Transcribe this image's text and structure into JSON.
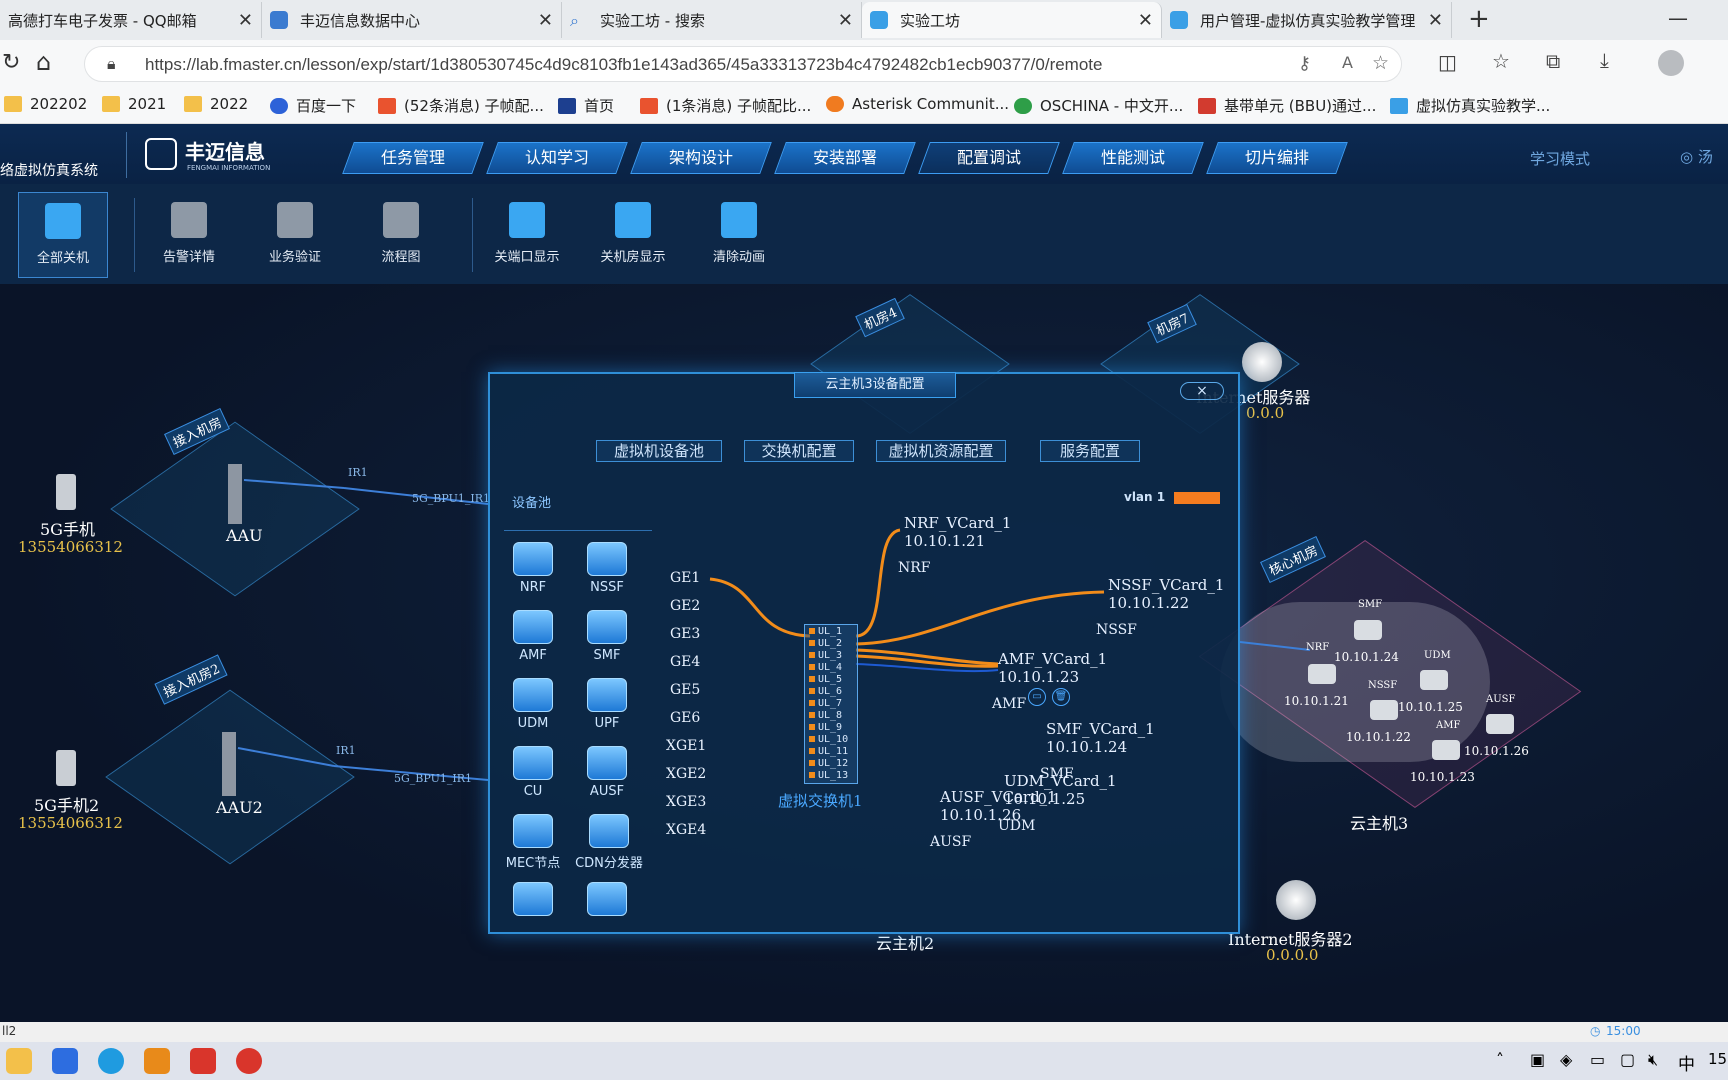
{
  "browser": {
    "tabs": [
      {
        "title": "高德打车电子发票 - QQ邮箱",
        "icon": "mail-icon",
        "active": false
      },
      {
        "title": "丰迈信息数据中心",
        "icon": "site-icon",
        "active": false
      },
      {
        "title": "实验工坊 - 搜索",
        "icon": "search-icon",
        "active": false
      },
      {
        "title": "实验工坊",
        "icon": "cloud-icon",
        "active": true
      },
      {
        "title": "用户管理-虚拟仿真实验教学管理",
        "icon": "cloud-icon",
        "active": false
      }
    ],
    "url": "https://lab.fmaster.cn/lesson/exp/start/1d380530745c4d9c8103fb1e143ad365/45a33313723b4c4792482cb1ecb90377/0/remote",
    "bookmarks": [
      "202202",
      "2021",
      "2022",
      "百度一下",
      "(52条消息) 子帧配...",
      "首页",
      "(1条消息) 子帧配比...",
      "Asterisk Communit...",
      "OSCHINA - 中文开...",
      "基带单元 (BBU)通过...",
      "虚拟仿真实验教学..."
    ]
  },
  "app": {
    "system_name": "络虚拟仿真系统",
    "brand": "丰迈信息",
    "brand_en": "FENGMAI INFORMATION",
    "menu": [
      "任务管理",
      "认知学习",
      "架构设计",
      "安装部署",
      "配置调试",
      "性能测试",
      "切片编排"
    ],
    "mode": "学习模式",
    "user": "汤",
    "toolbar": [
      "全部关机",
      "告警详情",
      "业务验证",
      "流程图",
      "关端口显示",
      "关机房显示",
      "清除动画"
    ]
  },
  "topology": {
    "rooms": [
      "机房4",
      "机房7",
      "接入机房",
      "接入机房2",
      "核心机房"
    ],
    "phone1": {
      "name": "5G手机",
      "number": "13554066312"
    },
    "phone2": {
      "name": "5G手机2",
      "number": "13554066312"
    },
    "aau1": "AAU",
    "aau2": "AAU2",
    "link1": "5G_BPU1_IR1",
    "link2": "5G_BPU1_IR1",
    "ir1": "IR1",
    "ir2": "IR1",
    "internet1": {
      "name": "Internet服务器",
      "ip": "0.0.0"
    },
    "internet2": {
      "name": "Internet服务器2",
      "ip": "0.0.0.0"
    },
    "cloud2": "云主机2",
    "cloud3": "云主机3",
    "cloud3_nodes": [
      {
        "name": "SMF",
        "ip": "10.10.1.24"
      },
      {
        "name": "NRF",
        "ip": "10.10.1.21"
      },
      {
        "name": "UDM",
        "ip": "10.10.1.25"
      },
      {
        "name": "NSSF",
        "ip": "10.10.1.22"
      },
      {
        "name": "AUSF",
        "ip": "10.10.1.26"
      },
      {
        "name": "AMF",
        "ip": "10.10.1.23"
      }
    ]
  },
  "dialog": {
    "title": "云主机3设备配置",
    "close": "×",
    "tabs": [
      "虚拟机设备池",
      "交换机配置",
      "虚拟机资源配置",
      "服务配置"
    ],
    "pool_title": "设备池",
    "pool": [
      "NRF",
      "NSSF",
      "AMF",
      "SMF",
      "UDM",
      "UPF",
      "CU",
      "AUSF",
      "MEC节点",
      "CDN分发器"
    ],
    "ports": [
      "GE1",
      "GE2",
      "GE3",
      "GE4",
      "GE5",
      "GE6",
      "XGE1",
      "XGE2",
      "XGE3",
      "XGE4"
    ],
    "switch_ports": [
      "UL_1",
      "UL_2",
      "UL_3",
      "UL_4",
      "UL_5",
      "UL_6",
      "UL_7",
      "UL_8",
      "UL_9",
      "UL_10",
      "UL_11",
      "UL_12",
      "UL_13"
    ],
    "switch_name": "虚拟交换机1",
    "vlan": "vlan 1",
    "vlan_color": "#f57c1f",
    "vms": [
      {
        "card": "NRF_VCard_1",
        "ip": "10.10.1.21",
        "name": "NRF"
      },
      {
        "card": "NSSF_VCard_1",
        "ip": "10.10.1.22",
        "name": "NSSF"
      },
      {
        "card": "AMF_VCard_1",
        "ip": "10.10.1.23",
        "name": "AMF"
      },
      {
        "card": "SMF_VCard_1",
        "ip": "10.10.1.24",
        "name": "SMF"
      },
      {
        "card": "UDM_VCard_1",
        "ip": "10.10.1.25",
        "name": "UDM"
      },
      {
        "card": "AUSF_VCard_1",
        "ip": "10.10.1.26",
        "name": "AUSF"
      }
    ]
  },
  "status": {
    "left": "ll2",
    "time": "15:00"
  },
  "taskbar": {
    "clock": "15",
    "ime": "中"
  }
}
